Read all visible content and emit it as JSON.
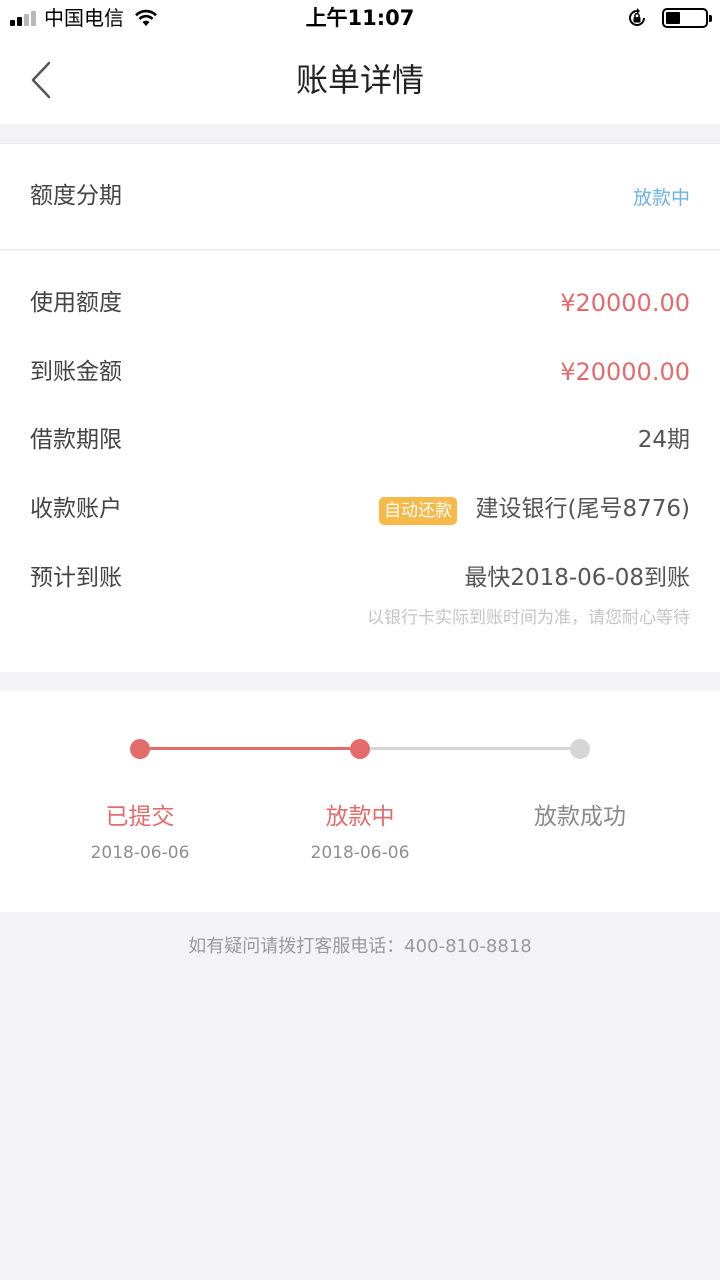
{
  "status_bar": {
    "carrier": "中国电信",
    "time": "上午11:07"
  },
  "nav": {
    "title": "账单详情"
  },
  "loan": {
    "type_label": "额度分期",
    "status": "放款中"
  },
  "details": {
    "used_limit_label": "使用额度",
    "used_limit_value": "¥20000.00",
    "received_label": "到账金额",
    "received_value": "¥20000.00",
    "term_label": "借款期限",
    "term_value": "24期",
    "account_label": "收款账户",
    "account_badge": "自动还款",
    "account_value": "建设银行(尾号8776)",
    "arrival_label": "预计到账",
    "arrival_value": "最快2018-06-08到账",
    "arrival_note": "以银行卡实际到账时间为准，请您耐心等待"
  },
  "progress": {
    "steps": [
      {
        "label": "已提交",
        "date": "2018-06-06",
        "done": true
      },
      {
        "label": "放款中",
        "date": "2018-06-06",
        "done": true
      },
      {
        "label": "放款成功",
        "date": "",
        "done": false
      }
    ],
    "colors": {
      "active": "#e46b6b",
      "inactive": "#d6d6d6",
      "inactive_text": "#8a8a8a"
    }
  },
  "footer": {
    "contact": "如有疑问请拨打客服电话：400-810-8818"
  }
}
